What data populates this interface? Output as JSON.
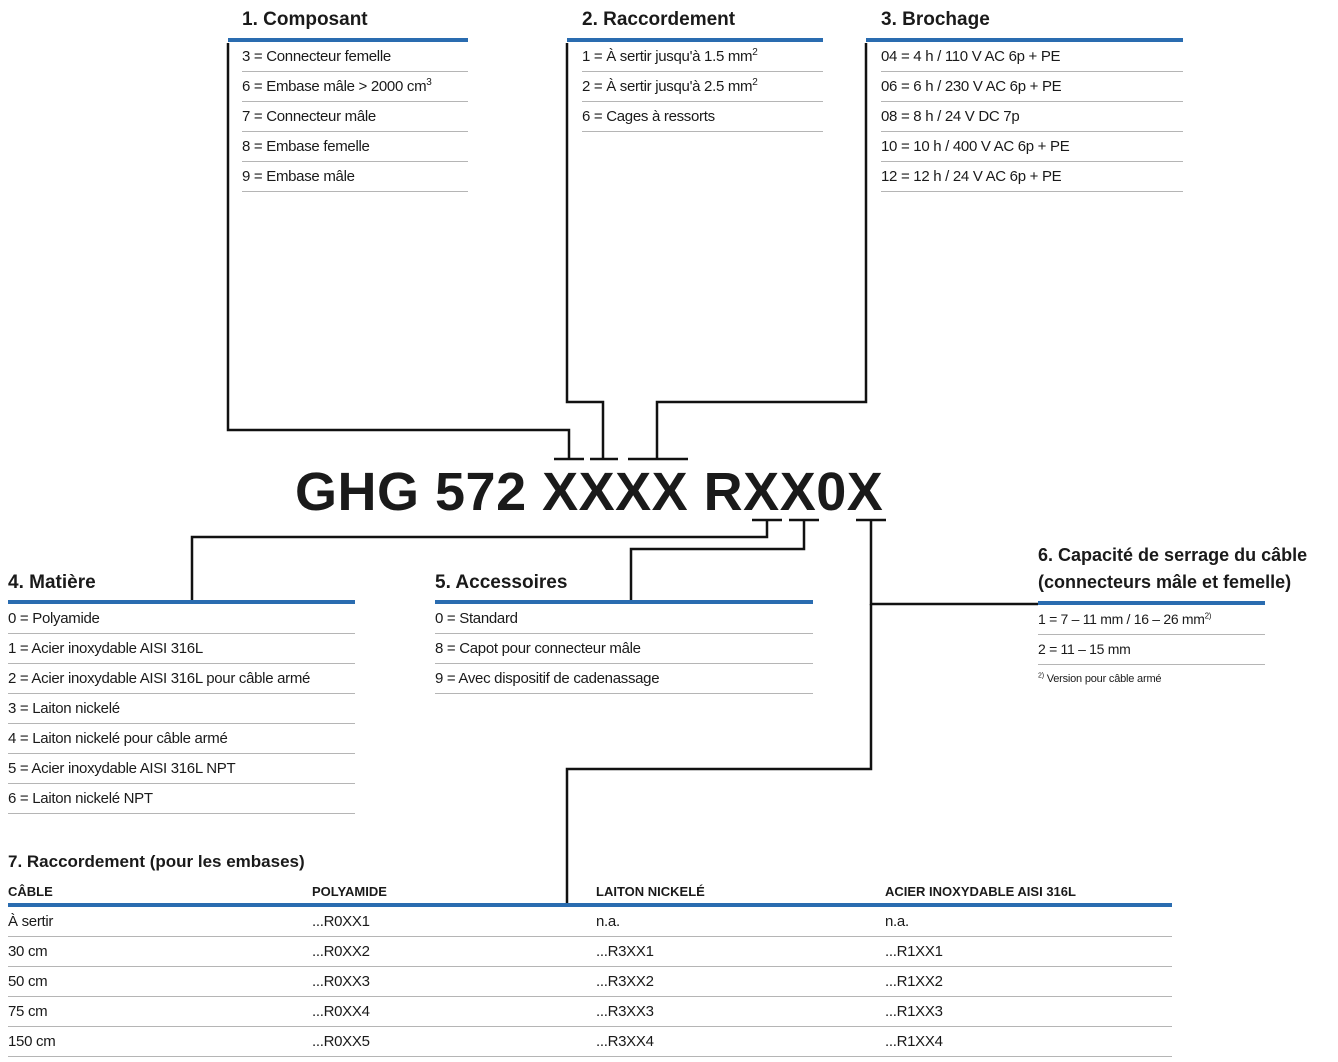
{
  "code": "GHG 572 XXXX RXX0X",
  "composant": {
    "title": "1. Composant",
    "items": [
      {
        "text": "3 = Connecteur femelle",
        "sup": ""
      },
      {
        "text": "6 = Embase mâle > 2000 cm",
        "sup": "3"
      },
      {
        "text": "7 = Connecteur mâle",
        "sup": ""
      },
      {
        "text": "8 = Embase femelle",
        "sup": ""
      },
      {
        "text": "9 = Embase mâle",
        "sup": ""
      }
    ]
  },
  "raccordement": {
    "title": "2. Raccordement",
    "items": [
      {
        "text": "1 = À sertir jusqu'à 1.5 mm",
        "sup": "2"
      },
      {
        "text": "2 = À sertir jusqu'à 2.5 mm",
        "sup": "2"
      },
      {
        "text": "6 = Cages à ressorts",
        "sup": ""
      }
    ]
  },
  "brochage": {
    "title": "3. Brochage",
    "items": [
      {
        "text": "04 = 4 h / 110 V AC 6p + PE",
        "sup": ""
      },
      {
        "text": "06 = 6 h / 230 V AC 6p + PE",
        "sup": ""
      },
      {
        "text": "08 = 8 h / 24 V DC 7p",
        "sup": ""
      },
      {
        "text": "10 = 10 h / 400 V AC 6p + PE",
        "sup": ""
      },
      {
        "text": "12 = 12 h / 24 V AC 6p + PE",
        "sup": ""
      }
    ]
  },
  "matiere": {
    "title": "4. Matière",
    "items": [
      {
        "text": "0 = Polyamide",
        "sup": ""
      },
      {
        "text": "1 = Acier inoxydable AISI 316L",
        "sup": ""
      },
      {
        "text": "2 = Acier inoxydable AISI 316L pour câble armé",
        "sup": ""
      },
      {
        "text": "3 = Laiton nickelé",
        "sup": ""
      },
      {
        "text": "4 = Laiton nickelé pour câble armé",
        "sup": ""
      },
      {
        "text": "5 = Acier inoxydable AISI 316L NPT",
        "sup": ""
      },
      {
        "text": "6 = Laiton nickelé NPT",
        "sup": ""
      }
    ]
  },
  "accessoires": {
    "title": "5. Accessoires",
    "items": [
      {
        "text": "0 = Standard",
        "sup": ""
      },
      {
        "text": "8 = Capot pour connecteur mâle",
        "sup": ""
      },
      {
        "text": "9 = Avec dispositif de cadenassage",
        "sup": ""
      }
    ]
  },
  "serrage": {
    "title_line1": "6. Capacité de serrage du câble",
    "title_line2": "(connecteurs mâle et femelle)",
    "items": [
      {
        "text": "1 = 7 – 11 mm / 16 – 26 mm",
        "sup": "2)"
      },
      {
        "text": "2 = 11 – 15 mm",
        "sup": ""
      }
    ],
    "footnote_sup": "2)",
    "footnote": "Version pour câble armé"
  },
  "table": {
    "title": "7. Raccordement (pour les embases)",
    "headers": [
      "CÂBLE",
      "POLYAMIDE",
      "LAITON NICKELÉ",
      "ACIER INOXYDABLE AISI 316L"
    ],
    "rows": [
      [
        "À sertir",
        "...R0XX1",
        "n.a.",
        "n.a."
      ],
      [
        "30 cm",
        "...R0XX2",
        "...R3XX1",
        "...R1XX1"
      ],
      [
        "50 cm",
        "...R0XX3",
        "...R3XX2",
        "...R1XX2"
      ],
      [
        "75 cm",
        "...R0XX4",
        "...R3XX3",
        "...R1XX3"
      ],
      [
        "150 cm",
        "...R0XX5",
        "...R3XX4",
        "...R1XX4"
      ]
    ]
  },
  "colors": {
    "accent": "#2a6cb0",
    "text": "#1a1a1a",
    "divider": "#b5b5b5"
  }
}
